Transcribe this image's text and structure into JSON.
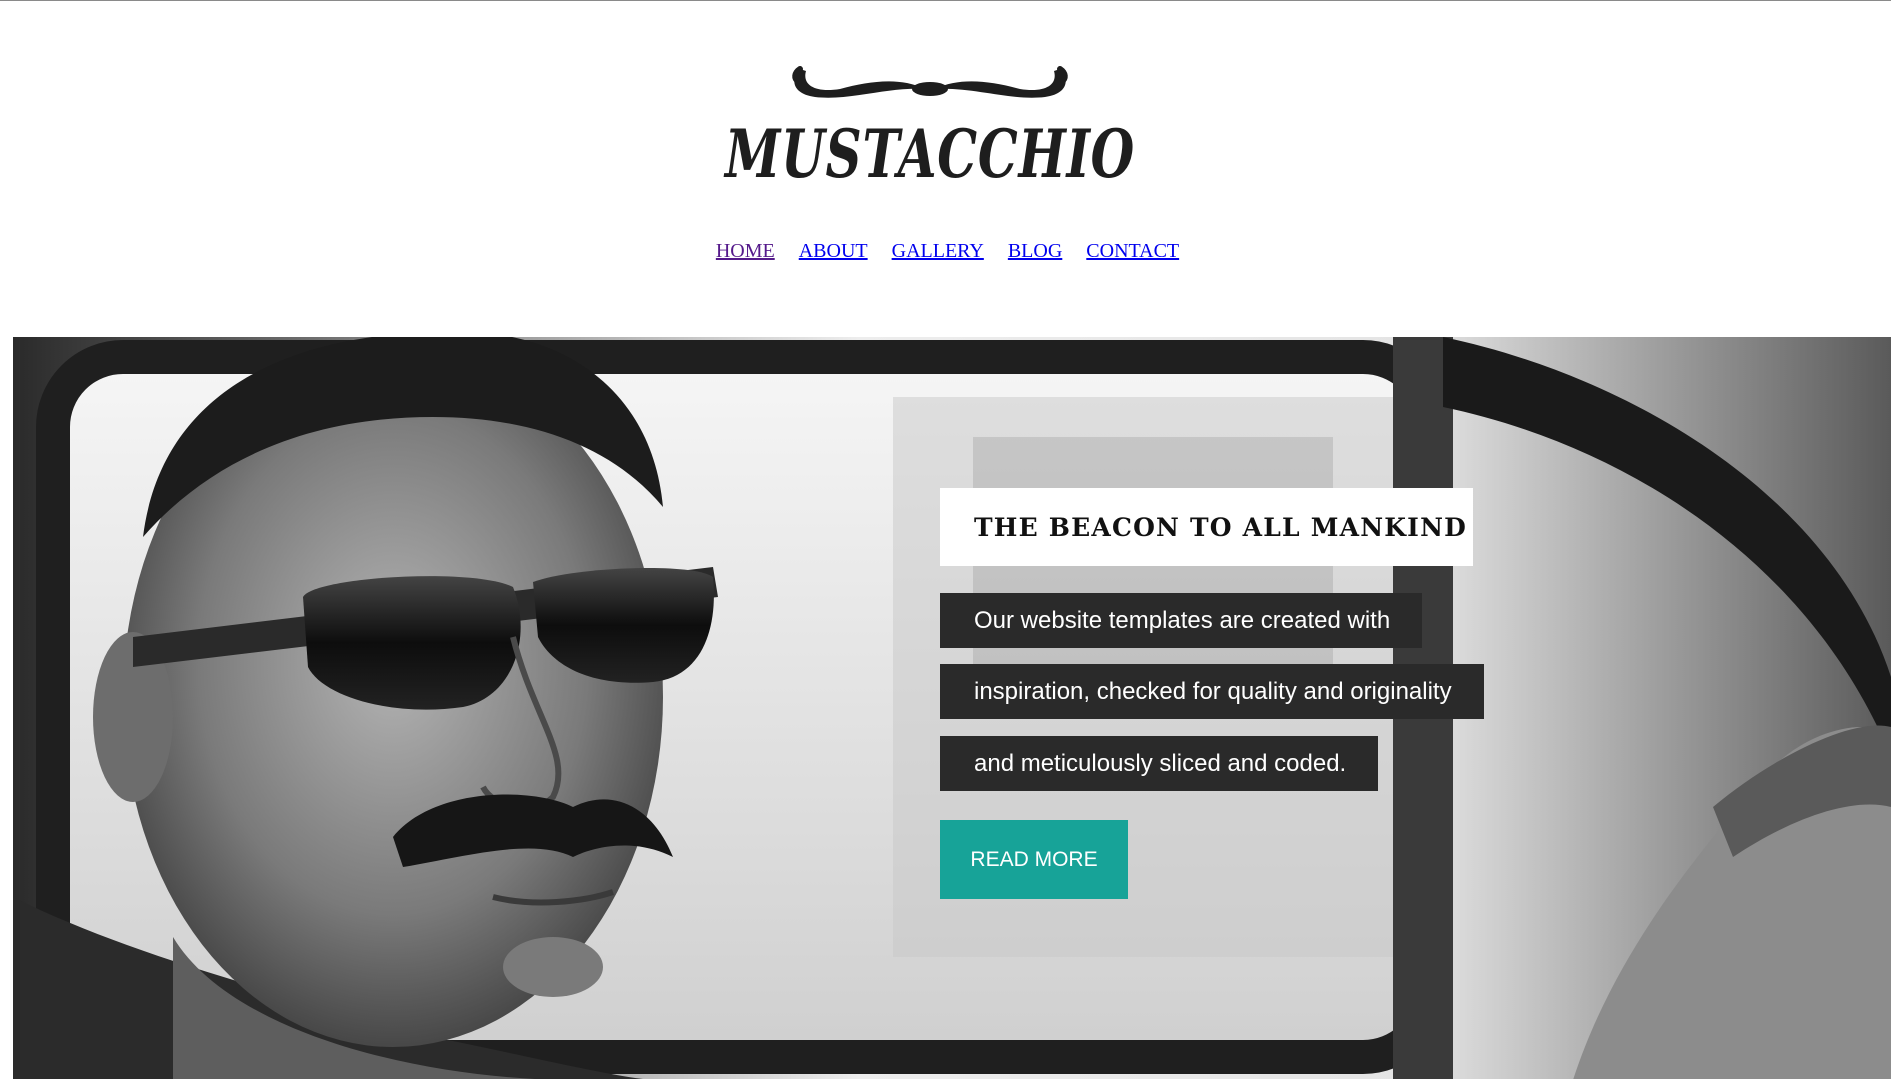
{
  "header": {
    "logo_text": "MUSTACCHIO"
  },
  "nav": {
    "items": [
      {
        "label": "HOME",
        "visited": true
      },
      {
        "label": "ABOUT",
        "visited": false
      },
      {
        "label": "GALLERY",
        "visited": false
      },
      {
        "label": "BLOG",
        "visited": false
      },
      {
        "label": "CONTACT",
        "visited": false
      }
    ],
    "link_color": "#0000ee",
    "visited_color": "#551a8b"
  },
  "hero": {
    "image": "black-and-white photo of a man with a mustache and sunglasses in a car",
    "headline": "THE BEACON TO ALL MANKIND",
    "description_lines": [
      "Our website templates are created with",
      "inspiration, checked for quality and originality",
      "and meticulously sliced and coded."
    ],
    "cta_label": "READ MORE",
    "cta_color": "#17a398",
    "text_box_color": "#2a2a2a"
  }
}
